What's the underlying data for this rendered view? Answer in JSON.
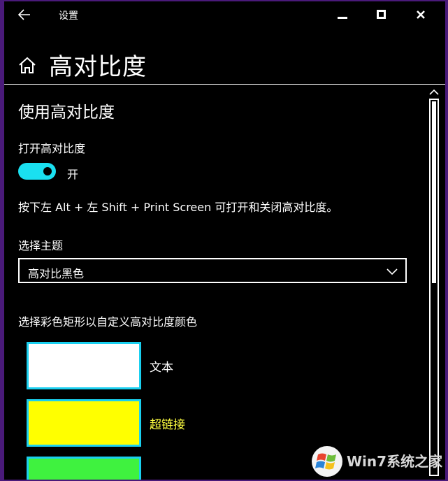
{
  "titlebar": {
    "app_title": "设置"
  },
  "header": {
    "page_title": "高对比度"
  },
  "content": {
    "section_title": "使用高对比度",
    "toggle_label": "打开高对比度",
    "toggle_state": "开",
    "shortcut_text": "按下左 Alt + 左 Shift + Print Screen 可打开和关闭高对比度。",
    "theme_label": "选择主题",
    "theme_value": "高对比黑色",
    "swatch_title": "选择彩色矩形以自定义高对比度颜色",
    "swatches": [
      {
        "label": "文本",
        "fill": "#ffffff",
        "text_color": "#ffffff"
      },
      {
        "label": "超链接",
        "fill": "#ffff00",
        "text_color": "#ffff40"
      },
      {
        "label": "",
        "fill": "#3ff23f",
        "text_color": "#3ff23f"
      }
    ]
  },
  "colors": {
    "accent": "#1ae0f0",
    "background": "#000000",
    "frame": "#4a1a7a"
  },
  "watermark": {
    "text": "Win7系统之家"
  }
}
